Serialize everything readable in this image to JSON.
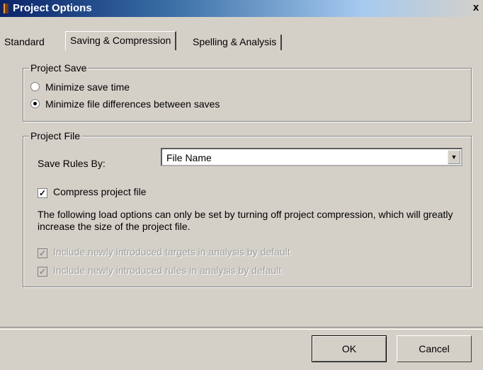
{
  "window": {
    "title": "Project Options",
    "close_glyph": "x"
  },
  "tabs": [
    {
      "label": "Standard"
    },
    {
      "label": "Saving & Compression"
    },
    {
      "label": "Spelling & Analysis"
    }
  ],
  "project_save": {
    "legend": "Project Save",
    "options": [
      {
        "label": "Minimize save time",
        "checked": false
      },
      {
        "label": "Minimize file differences between saves",
        "checked": true
      }
    ]
  },
  "project_file": {
    "legend": "Project File",
    "save_rules_label": "Save Rules By:",
    "save_rules_value": "File Name",
    "compress_label": "Compress project file",
    "compress_checked": true,
    "note": "The following load options can only be set by turning off project compression, which will greatly increase the size of the project file.",
    "include_targets_label": "Include newly introduced targets in analysis by default",
    "include_rules_label": "Include newly introduced rules in analysis by default"
  },
  "buttons": {
    "ok": "OK",
    "cancel": "Cancel"
  },
  "colors": {
    "dialog_bg": "#d4d0c8",
    "titlebar": "#0a246a"
  }
}
